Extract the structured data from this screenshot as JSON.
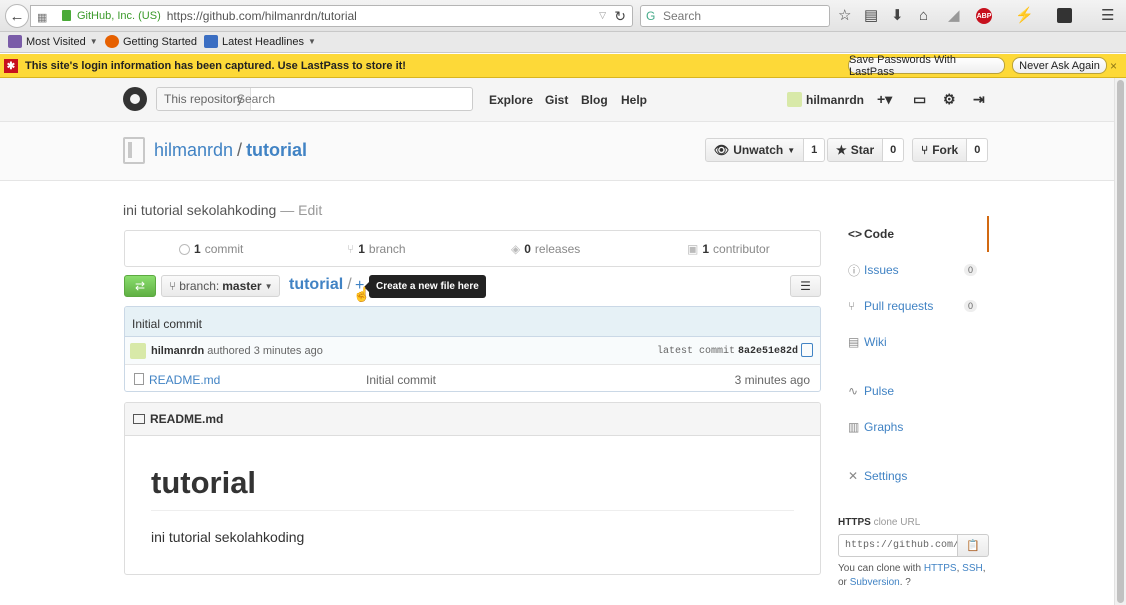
{
  "browser": {
    "identity": "GitHub, Inc. (US)",
    "url": "https://github.com/hilmanrdn/tutorial",
    "search_placeholder": "Search"
  },
  "bookmarks": [
    {
      "label": "Most Visited",
      "color": "#7a5ca8"
    },
    {
      "label": "Getting Started",
      "color": "#e66000"
    },
    {
      "label": "Latest Headlines",
      "color": "#3b6ec2"
    }
  ],
  "lastpass": {
    "message": "This site's login information has been captured. Use LastPass to store it!",
    "save_button": "Save Passwords With LastPass",
    "never_button": "Never Ask Again",
    "close": "×"
  },
  "header": {
    "search_scope": "This repository",
    "search_placeholder": "Search",
    "nav": [
      "Explore",
      "Gist",
      "Blog",
      "Help"
    ],
    "username": "hilmanrdn"
  },
  "repo": {
    "owner": "hilmanrdn",
    "separator": "/",
    "name": "tutorial",
    "watch_label": "Unwatch",
    "watch_count": "1",
    "star_label": "Star",
    "star_count": "0",
    "fork_label": "Fork",
    "fork_count": "0",
    "description": "ini tutorial sekolahkoding",
    "edit_label": "— Edit"
  },
  "summary": {
    "commits_num": "1",
    "commits_label": "commit",
    "branches_num": "1",
    "branches_label": "branch",
    "releases_num": "0",
    "releases_label": "releases",
    "contributors_num": "1",
    "contributors_label": "contributor"
  },
  "filenav": {
    "branch_prefix": "branch:",
    "branch": "master",
    "crumb": "tutorial",
    "slash": "/",
    "plus": "+",
    "tooltip": "Create a new file here"
  },
  "commit": {
    "message": "Initial commit",
    "author": "hilmanrdn",
    "authored": "authored 3 minutes ago",
    "latest_label": "latest commit",
    "sha": "8a2e51e82d"
  },
  "files": [
    {
      "name": "README.md",
      "message": "Initial commit",
      "age": "3 minutes ago"
    }
  ],
  "readme": {
    "header": "README.md",
    "title": "tutorial",
    "body": "ini tutorial sekolahkoding"
  },
  "sidebar": {
    "items": [
      {
        "label": "Code",
        "icon": "<>"
      },
      {
        "label": "Issues",
        "icon": "ⓘ",
        "count": "0"
      },
      {
        "label": "Pull requests",
        "icon": "⑂",
        "count": "0"
      },
      {
        "label": "Wiki",
        "icon": "▤"
      },
      {
        "label": "Pulse",
        "icon": "∿"
      },
      {
        "label": "Graphs",
        "icon": "▥"
      },
      {
        "label": "Settings",
        "icon": "✕"
      }
    ]
  },
  "clone": {
    "protocol": "HTTPS",
    "label": "clone URL",
    "url": "https://github.com/hilmanrdn/tutorial.git",
    "help_prefix": "You can clone with",
    "https": "HTTPS",
    "comma": ",",
    "ssh": "SSH",
    "or": "or",
    "subversion": "Subversion",
    "period": "."
  },
  "colors": {
    "link": "#4183c4",
    "lastpass_bg": "#fdd938",
    "compare_green": "#60b044",
    "active_tab": "#d26911"
  }
}
